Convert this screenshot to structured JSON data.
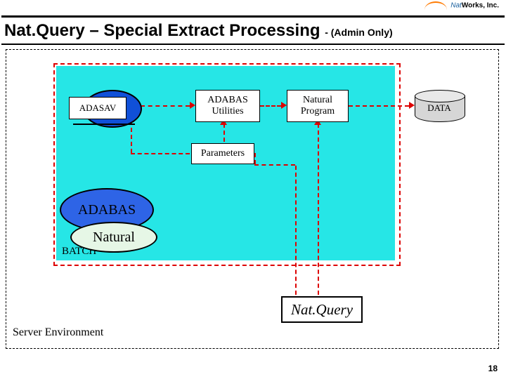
{
  "logo": {
    "line1": "Nat",
    "line2": "Works, Inc."
  },
  "title": {
    "main": "Nat.Query – Special Extract Processing ",
    "sub": "- (Admin Only)"
  },
  "server_label": "Server Environment",
  "batch_label": "BATCH",
  "nodes": {
    "adasav": "ADASAV",
    "utilities": "ADABAS Utilities",
    "nat_program": "Natural Program",
    "data": "DATA",
    "parameters": "Parameters",
    "adabas": "ADABAS",
    "natural": "Natural",
    "natquery": "Nat.Query"
  },
  "page": "18"
}
